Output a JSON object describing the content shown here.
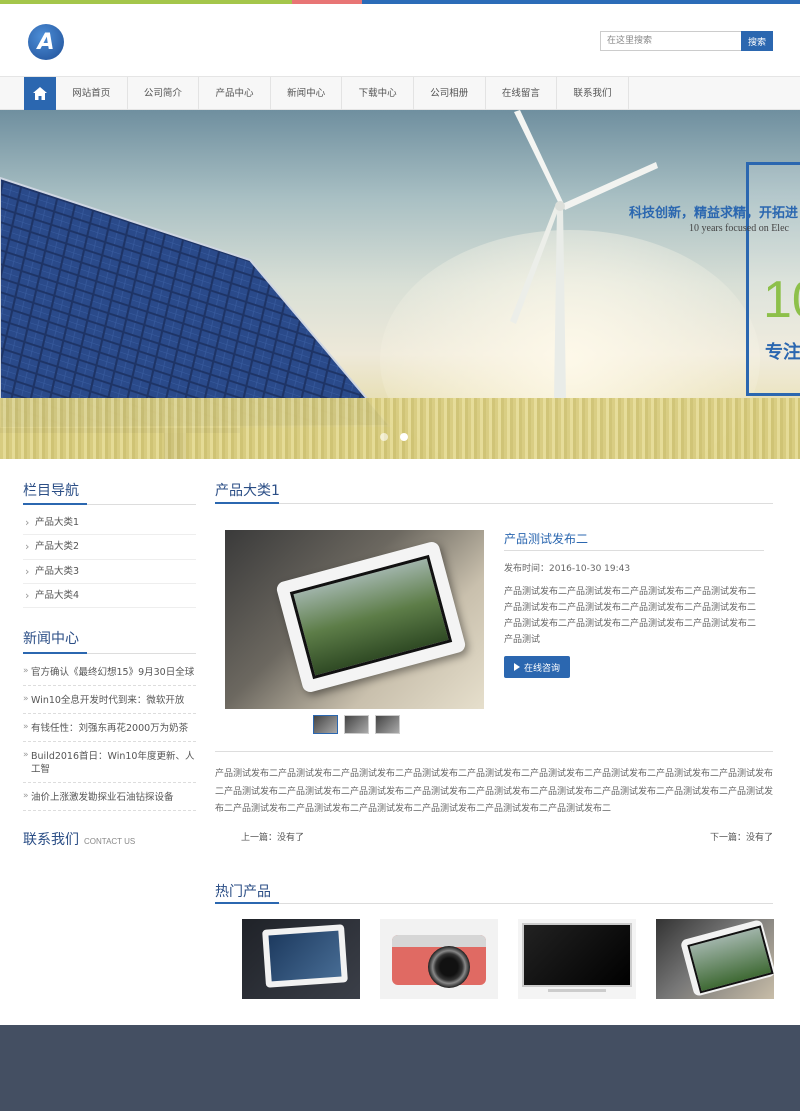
{
  "colors": {
    "accent_blue": "#2b67b0",
    "title_blue": "#2b4e86",
    "accent_green": "#a4c64b",
    "accent_red": "#e87575",
    "footer": "#444f62"
  },
  "header": {
    "logo_text": "A",
    "search_placeholder": "在这里搜索",
    "search_button": "搜索"
  },
  "nav": {
    "home_icon": "home-icon",
    "items": [
      "网站首页",
      "公司简介",
      "产品中心",
      "新闻中心",
      "下载中心",
      "公司相册",
      "在线留言",
      "联系我们"
    ]
  },
  "banner": {
    "slogan": "科技创新，精益求精，开拓进",
    "slogan_en": "10 years focused on Elec",
    "big_number": "10",
    "focus_text": "专注"
  },
  "sidebar": {
    "nav_title": "栏目导航",
    "categories": [
      "产品大类1",
      "产品大类2",
      "产品大类3",
      "产品大类4"
    ],
    "news_title": "新闻中心",
    "news": [
      "官方确认《最终幻想15》9月30日全球",
      "Win10全息开发时代到来：微软开放",
      "有钱任性：刘强东再花2000万为奶茶",
      "Build2016首日：Win10年度更新、人工智",
      "油价上涨激发勘探业石油钻探设备"
    ],
    "contact_title": "联系我们",
    "contact_en": "CONTACT US"
  },
  "main": {
    "category_title": "产品大类1",
    "product": {
      "title": "产品测试发布二",
      "date": "发布时间：2016-10-30 19:43",
      "description": "产品测试发布二产品测试发布二产品测试发布二产品测试发布二产品测试发布二产品测试发布二产品测试发布二产品测试发布二产品测试发布二产品测试发布二产品测试发布二产品测试发布二产品测试",
      "consult_button": "在线咨询"
    },
    "article": "产品测试发布二产品测试发布二产品测试发布二产品测试发布二产品测试发布二产品测试发布二产品测试发布二产品测试发布二产品测试发布二产品测试发布二产品测试发布二产品测试发布二产品测试发布二产品测试发布二产品测试发布二产品测试发布二产品测试发布二产品测试发布二产品测试发布二产品测试发布二产品测试发布二产品测试发布二产品测试发布二产品测试发布二",
    "prev": "上一篇：没有了",
    "next": "下一篇：没有了",
    "hot_title": "热门产品"
  }
}
